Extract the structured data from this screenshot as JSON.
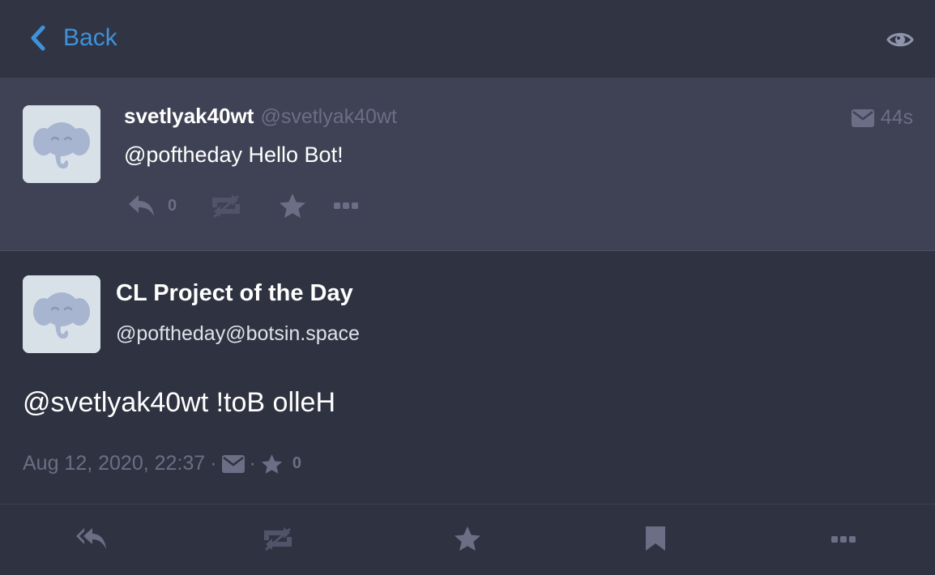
{
  "header": {
    "back_label": "Back",
    "icons": {
      "back": "chevron-left-icon",
      "visibility": "eye-icon"
    }
  },
  "reply_toot": {
    "display_name": "svetlyak40wt",
    "acct": "@svetlyak40wt",
    "time_ago": "44s",
    "visibility_icon": "envelope-icon",
    "content_mention": "@poftheday",
    "content_text": " Hello Bot!",
    "reply_count": "0",
    "actions": [
      "reply-icon",
      "boost-disabled-icon",
      "star-icon",
      "ellipsis-icon"
    ]
  },
  "focused_toot": {
    "display_name": "CL Project of the Day",
    "acct": "@poftheday@botsin.space",
    "content_mention": "@svetlyak40wt",
    "content_text": " !toB olleH",
    "date": "Aug 12, 2020, 22:37",
    "separator": "·",
    "favourites_count": "0"
  },
  "bottom_actions": [
    "reply-all-icon",
    "boost-disabled-icon",
    "star-icon",
    "bookmark-icon",
    "ellipsis-icon"
  ],
  "colors": {
    "background": "#2f3240",
    "header": "#313443",
    "reply_background": "#3e4254",
    "accent": "#3d93db",
    "muted": "#6a6f85",
    "avatar_bg": "#d9e1e8",
    "avatar_elephant": "#a7b5d1"
  }
}
